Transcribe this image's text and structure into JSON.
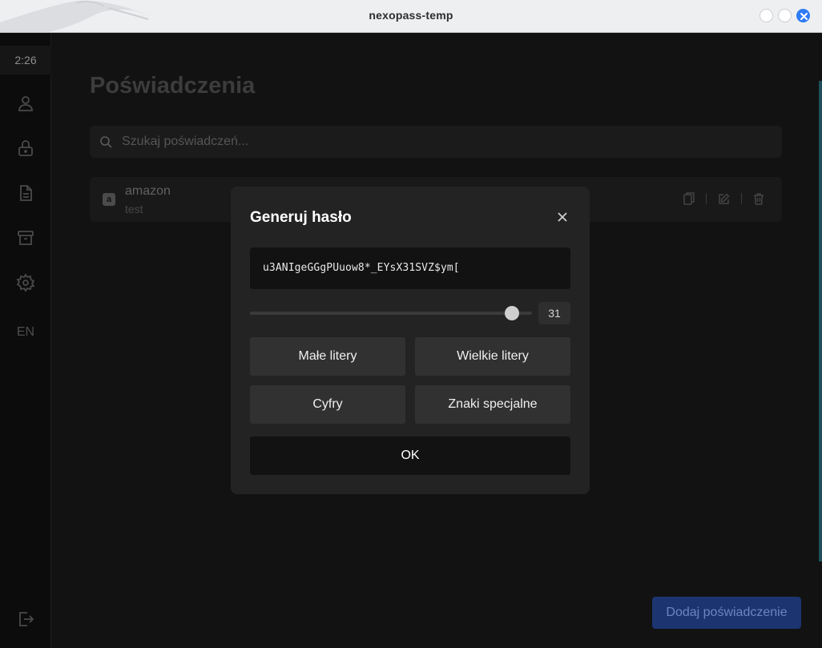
{
  "window": {
    "title": "nexopass-temp"
  },
  "sidebar": {
    "time": "2:26",
    "items": [
      {
        "icon": "user-icon"
      },
      {
        "icon": "lock-icon"
      },
      {
        "icon": "document-icon"
      },
      {
        "icon": "archive-icon"
      },
      {
        "icon": "gear-icon"
      }
    ],
    "language": "EN",
    "logout_icon": "logout-icon"
  },
  "main": {
    "title": "Poświadczenia",
    "search_placeholder": "Szukaj poświadczeń...",
    "credentials": [
      {
        "favicon_letter": "a",
        "name": "amazon",
        "username": "test"
      }
    ],
    "add_button": "Dodaj poświadczenie"
  },
  "modal": {
    "title": "Generuj hasło",
    "password": "u3ANIgeGGgPUuow8*_EYsX31SVZ$ym[",
    "length": {
      "value": 31,
      "fraction": 0.93
    },
    "options": {
      "lowercase": "Małe litery",
      "uppercase": "Wielkie litery",
      "digits": "Cyfry",
      "special": "Znaki specjalne"
    },
    "ok_label": "OK"
  },
  "colors": {
    "accent": "#2f7bf6",
    "add_button": "#1c3570"
  }
}
